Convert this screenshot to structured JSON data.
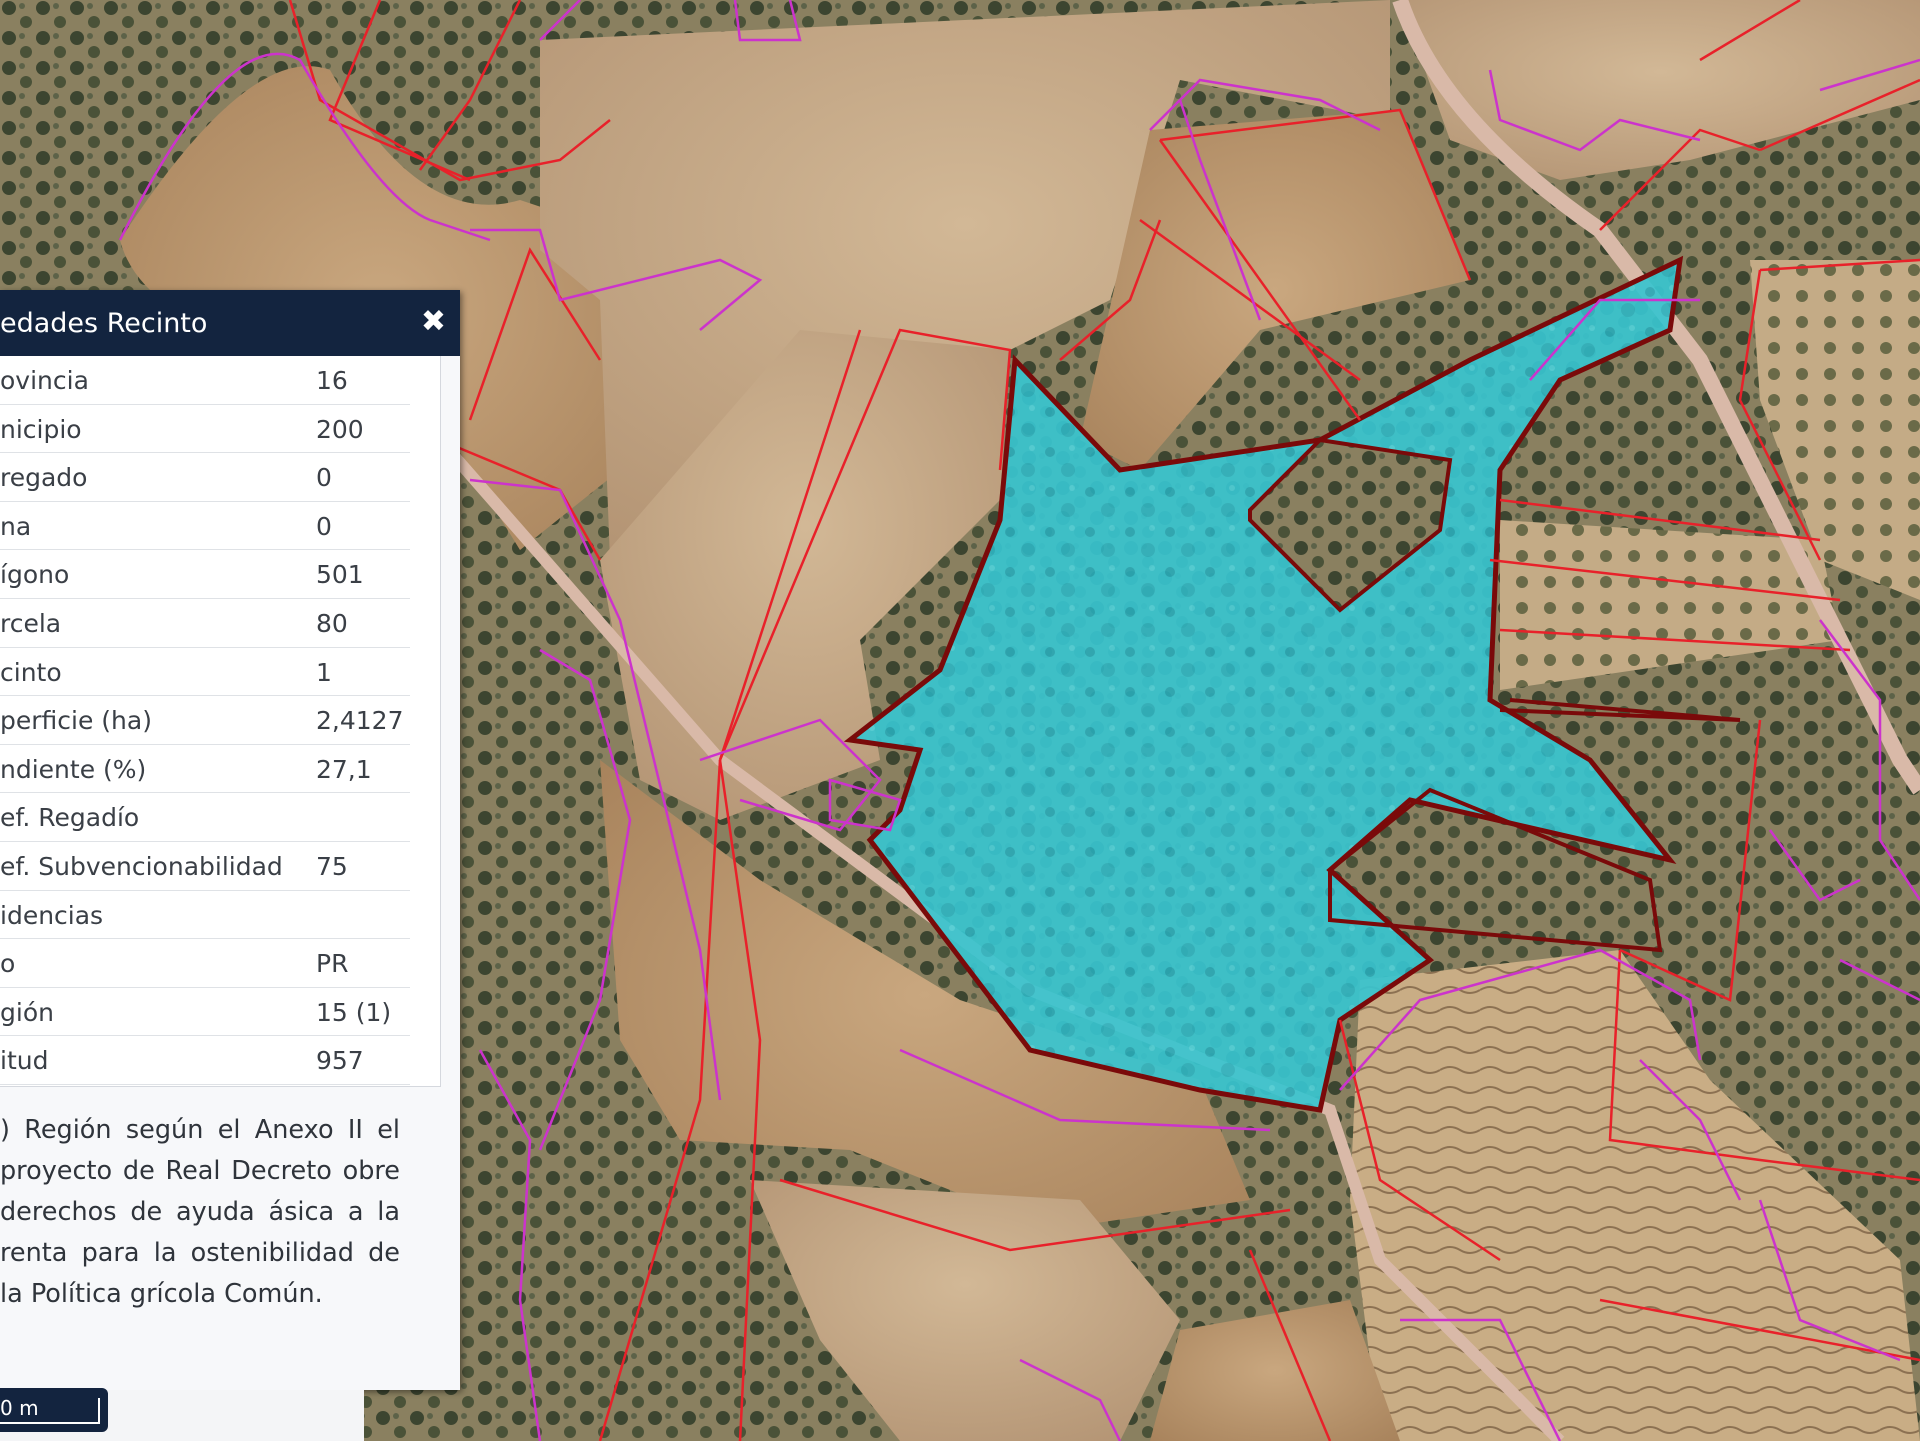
{
  "panel": {
    "title": "edades Recinto",
    "close_icon": "close-icon",
    "properties": [
      {
        "key": "ovincia",
        "value": "16"
      },
      {
        "key": "nicipio",
        "value": "200"
      },
      {
        "key": "regado",
        "value": "0"
      },
      {
        "key": "na",
        "value": "0"
      },
      {
        "key": "ígono",
        "value": "501"
      },
      {
        "key": "rcela",
        "value": "80"
      },
      {
        "key": "cinto",
        "value": "1"
      },
      {
        "key": "perficie (ha)",
        "value": "2,4127"
      },
      {
        "key": "ndiente (%)",
        "value": "27,1"
      },
      {
        "key": "ef. Regadío",
        "value": ""
      },
      {
        "key": "ef. Subvencionabilidad",
        "value": "75"
      },
      {
        "key": "idencias",
        "value": ""
      },
      {
        "key": "o",
        "value": "PR"
      },
      {
        "key": "gión",
        "value": "15 (1)"
      },
      {
        "key": "itud",
        "value": "957"
      }
    ],
    "footnote": ") Región según el Anexo II el proyecto de Real Decreto obre derechos de ayuda ásica a la renta para la ostenibilidad de la Política grícola Común."
  },
  "scale_bar": {
    "label": "0 m"
  },
  "map": {
    "selected_parcel_color": "#33c6d2",
    "selected_outline_color": "#7a0a0a",
    "parcel_line_color": "#e8212a",
    "boundary_line_color": "#cc33cc"
  }
}
